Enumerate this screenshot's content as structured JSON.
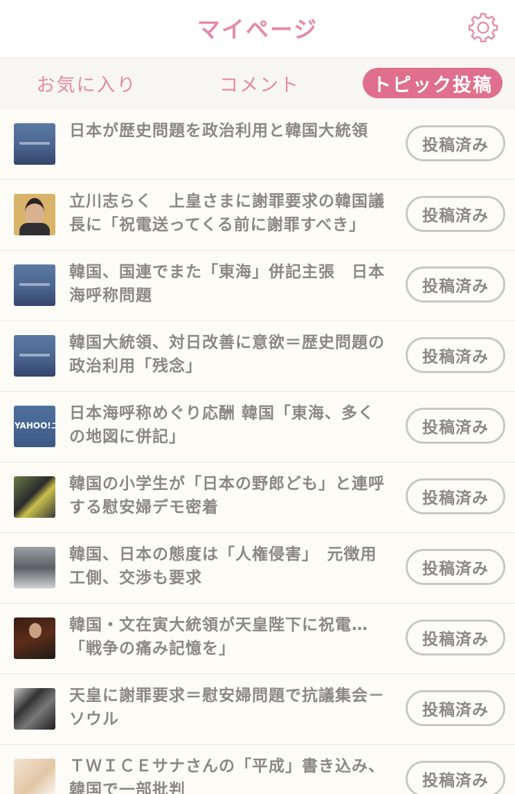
{
  "header": {
    "title": "マイページ",
    "settings_icon": "gear-icon"
  },
  "tabs": [
    {
      "label": "お気に入り",
      "active": false
    },
    {
      "label": "コメント",
      "active": false
    },
    {
      "label": "トピック投稿",
      "active": true
    }
  ],
  "colors": {
    "accent": "#df6f8c",
    "accent_text": "#e68aa5",
    "text": "#8a8886"
  },
  "items": [
    {
      "title": "日本が歴史問題を政治利用と韓国大統領",
      "status": "投稿済み",
      "thumbnail": "city-skyline"
    },
    {
      "title": "立川志らく　上皇さまに謝罪要求の韓国議長に「祝電送ってくる前に謝罪すべき」",
      "status": "投稿済み",
      "thumbnail": "portrait"
    },
    {
      "title": "韓国、国連でまた「東海」併記主張　日本海呼称問題",
      "status": "投稿済み",
      "thumbnail": "city-skyline"
    },
    {
      "title": "韓国大統領、対日改善に意欲＝歴史問題の政治利用「残念」",
      "status": "投稿済み",
      "thumbnail": "city-skyline"
    },
    {
      "title": "日本海呼称めぐり応酬  韓国「東海、多くの地図に併記」",
      "status": "投稿済み",
      "thumbnail": "yahoo-news",
      "thumbnail_text": "YAHOO!ニュース"
    },
    {
      "title": "韓国の小学生が「日本の野郎ども」と連呼する慰安婦デモ密着",
      "status": "投稿済み",
      "thumbnail": "demonstration"
    },
    {
      "title": "韓国、日本の態度は「人権侵害」　元徴用工側、交渉も要求",
      "status": "投稿済み",
      "thumbnail": "press"
    },
    {
      "title": "韓国・文在寅大統領が天皇陛下に祝電…「戦争の痛み記憶を」",
      "status": "投稿済み",
      "thumbnail": "speech"
    },
    {
      "title": "天皇に謝罪要求＝慰安婦問題で抗議集会－ソウル",
      "status": "投稿済み",
      "thumbnail": "rally"
    },
    {
      "title": "ＴＷＩＣＥサナさんの「平成」書き込み、韓国で一部批判",
      "status": "投稿済み",
      "thumbnail": "portrait-light"
    }
  ]
}
